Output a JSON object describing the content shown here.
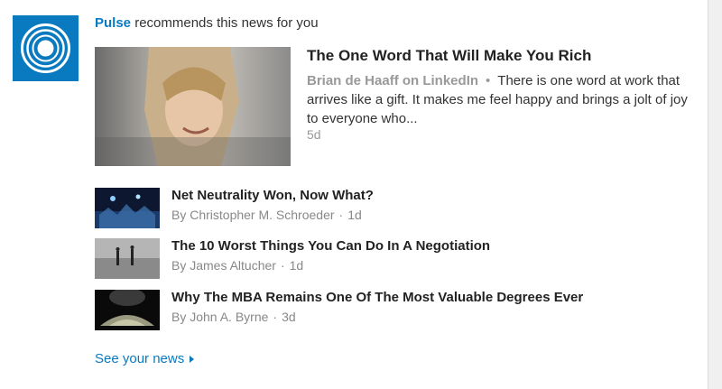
{
  "header": {
    "brand": "Pulse",
    "text": "recommends this news for you"
  },
  "icons": {
    "logo": "pulse-logo-icon",
    "more_arrow": "caret-right-icon"
  },
  "colors": {
    "accent": "#0a7ac0",
    "muted": "#999999"
  },
  "feature": {
    "title": "The One Word That Will Make You Rich",
    "author": "Brian de Haaff on LinkedIn",
    "separator": "•",
    "snippet": "There is one word at work that arrives like a gift. It makes me feel happy and brings a jolt of joy to everyone who...",
    "age": "5d"
  },
  "items": [
    {
      "title": "Net Neutrality Won, Now What?",
      "author": "By Christopher M. Schroeder",
      "sep": "·",
      "age": "1d"
    },
    {
      "title": "The 10 Worst Things You Can Do In A Negotiation",
      "author": "By James Altucher",
      "sep": "·",
      "age": "1d"
    },
    {
      "title": "Why The MBA Remains One Of The Most Valuable Degrees Ever",
      "author": "By John A. Byrne",
      "sep": "·",
      "age": "3d"
    }
  ],
  "footer": {
    "link": "See your news"
  }
}
